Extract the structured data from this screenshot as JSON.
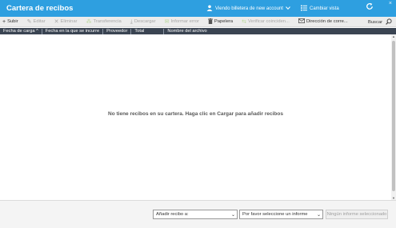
{
  "titlebar": {
    "title": "Cartera de recibos",
    "close": "×",
    "wallet_label": "Viendo billetera de new account",
    "view_label": "Cambiar vista"
  },
  "toolbar": {
    "upload": "Subir",
    "edit": "Editar",
    "delete": "Eliminar",
    "transfer": "Transferencia",
    "download": "Descargar",
    "report_error": "Informar error",
    "trash": "Papelera",
    "verify": "Verificar coinciden...",
    "email": "Dirección de corre...",
    "search": "Buscar"
  },
  "table": {
    "columns": [
      "Fecha de carga ^",
      "Fecha en la que se incurre",
      "Proveedor",
      "Total",
      "Nombre del archivo"
    ],
    "empty_message": "No tiene recibos en su cartera. Haga clic en Cargar para añadir recibos"
  },
  "footer": {
    "add_receipt_select": "Añadir recibo a:",
    "report_select": "Por favor seleccione un informe",
    "no_report_button": "Ningún informe seleccionado"
  }
}
